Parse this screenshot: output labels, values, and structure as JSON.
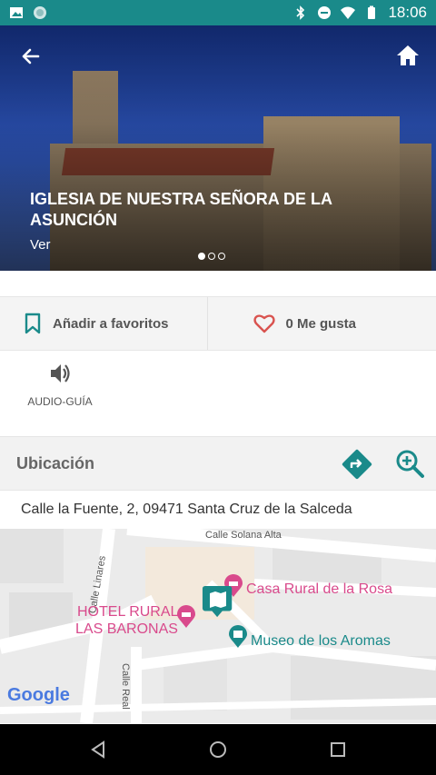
{
  "status_bar": {
    "time": "18:06",
    "left_icons": [
      "image-icon",
      "circle-app-icon"
    ],
    "right_icons": [
      "bluetooth-icon",
      "do-not-disturb-icon",
      "wifi-icon",
      "battery-icon"
    ]
  },
  "hero": {
    "title": "IGLESIA DE NUESTRA SEÑORA DE LA ASUNCIÓN",
    "link": "Ver",
    "slide_count": 3,
    "active_slide": 1
  },
  "actions": {
    "favorites_label": "Añadir a favoritos",
    "likes_label": "0 Me gusta"
  },
  "audio_guide": {
    "label": "AUDIO-GUÍA"
  },
  "location": {
    "title": "Ubicación",
    "address": "Calle la Fuente, 2, 09471 Santa Cruz de la Salceda"
  },
  "map": {
    "streets": [
      "Calle Solana Alta",
      "Calle Linares",
      "Calle Real"
    ],
    "places": [
      {
        "name": "Casa Rural de la Rosa",
        "color": "#d94a8c"
      },
      {
        "name": "HOTEL RURAL\nLAS BARONAS",
        "color": "#d94a8c"
      },
      {
        "name": "Museo de los Aromas",
        "color": "#1a8a8a"
      }
    ],
    "hotel_line1": "HOTEL RURAL",
    "hotel_line2": "LAS BARONAS",
    "provider": "Google"
  },
  "colors": {
    "accent": "#1a8a8a",
    "heart": "#d9534f",
    "hotel_pink": "#d94a8c"
  }
}
